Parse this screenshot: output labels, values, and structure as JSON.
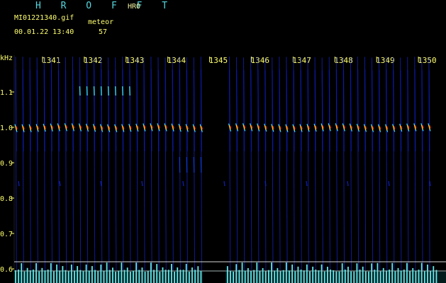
{
  "header": {
    "title": "H R O F F T",
    "station": "HRO",
    "file_name": "MI01221340.gif",
    "datetime": "00.01.22 13:40",
    "meteor_label": "meteor",
    "meteor_count": "57"
  },
  "axes": {
    "unit": "kHz",
    "y_ticks": [
      "1.1",
      "1.0",
      "0.9",
      "0.8",
      "0.7",
      "0.6"
    ],
    "x_ticks": [
      "1341",
      "1342",
      "1343",
      "1344",
      "1345",
      "1346",
      "1347",
      "1348",
      "1349",
      "1350"
    ]
  },
  "colors": {
    "background": "#000000",
    "title": "#56d7df",
    "text": "#ffff70",
    "axis_text": "#ffff70",
    "spectrum_blue": "#1d2fff",
    "spectrum_cyan": "#3de7ff",
    "spectrum_yellow": "#ffd11a",
    "spectrum_red": "#ff3a1a",
    "meter_cyan": "#63e7ea"
  },
  "chart_data": {
    "type": "heatmap",
    "x": [
      "1341",
      "1342",
      "1343",
      "1344",
      "1345",
      "1346",
      "1347",
      "1348",
      "1349",
      "1350"
    ],
    "y_unit": "kHz",
    "y_ticks": [
      "1.1",
      "1.0",
      "0.9",
      "0.8",
      "0.7",
      "0.6"
    ],
    "gap_tick": "1345",
    "echo_line_frequency_khz": 1.0,
    "meteor_count": "57"
  }
}
